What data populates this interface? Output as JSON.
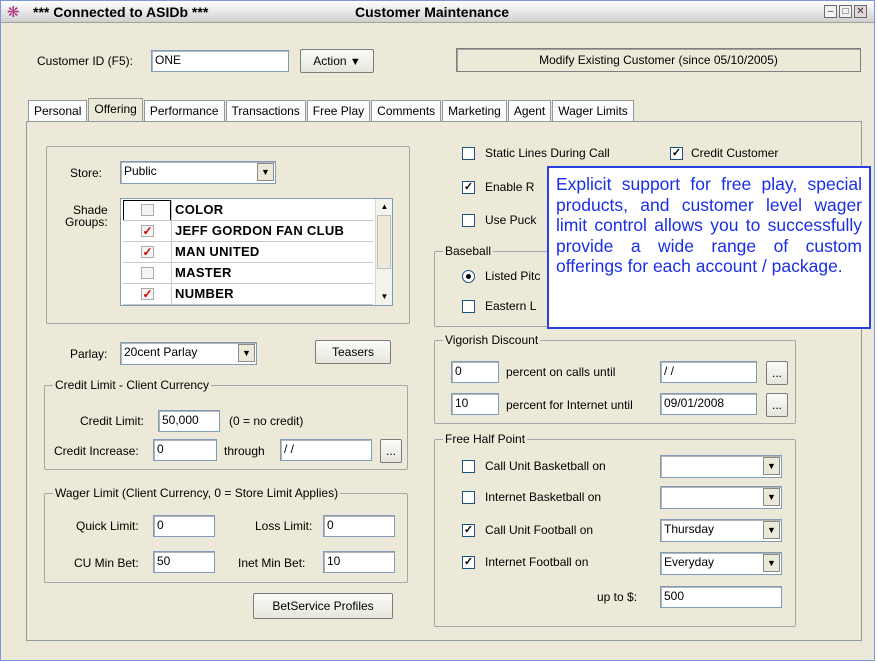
{
  "window": {
    "connection_title": "***   Connected to ASIDb   ***",
    "title": "Customer Maintenance",
    "controls": [
      "minimize",
      "maximize",
      "close"
    ]
  },
  "header": {
    "customer_id_label": "Customer ID (F5):",
    "customer_id_value": "ONE",
    "action_label": "Action",
    "status_text": "Modify Existing Customer (since 05/10/2005)"
  },
  "tabs": [
    {
      "label": "Personal",
      "active": false
    },
    {
      "label": "Offering",
      "active": true
    },
    {
      "label": "Performance",
      "active": false
    },
    {
      "label": "Transactions",
      "active": false
    },
    {
      "label": "Free Play",
      "active": false
    },
    {
      "label": "Comments",
      "active": false
    },
    {
      "label": "Marketing",
      "active": false
    },
    {
      "label": "Agent",
      "active": false
    },
    {
      "label": "Wager Limits",
      "active": false
    }
  ],
  "store": {
    "label": "Store:",
    "value": "Public"
  },
  "shade_groups": {
    "label_line1": "Shade",
    "label_line2": "Groups:",
    "items": [
      {
        "name": "COLOR",
        "checked": false
      },
      {
        "name": "JEFF GORDON FAN CLUB",
        "checked": true
      },
      {
        "name": "MAN UNITED",
        "checked": true
      },
      {
        "name": "MASTER",
        "checked": false
      },
      {
        "name": "NUMBER",
        "checked": true
      }
    ]
  },
  "parlay": {
    "label": "Parlay:",
    "value": "20cent Parlay",
    "teasers_label": "Teasers"
  },
  "credit_limit": {
    "group_title": "Credit Limit - Client Currency",
    "credit_limit_label": "Credit Limit:",
    "credit_limit_value": "50,000",
    "credit_limit_hint": "(0 = no credit)",
    "credit_increase_label": "Credit Increase:",
    "credit_increase_value": "0",
    "through_label": "through",
    "through_value": " / /",
    "browse_label": "..."
  },
  "wager_limit": {
    "group_title": "Wager Limit (Client Currency, 0 = Store Limit Applies)",
    "quick_limit_label": "Quick Limit:",
    "quick_limit_value": "0",
    "loss_limit_label": "Loss Limit:",
    "loss_limit_value": "0",
    "cu_min_bet_label": "CU Min Bet:",
    "cu_min_bet_value": "50",
    "inet_min_bet_label": "Inet Min Bet:",
    "inet_min_bet_value": "10",
    "betservice_label": "BetService Profiles"
  },
  "options": {
    "static_lines_label": "Static Lines During Call",
    "static_lines_checked": false,
    "credit_customer_label": "Credit Customer",
    "credit_customer_checked": true,
    "enable_label": "Enable R",
    "enable_checked": true,
    "use_puck_label": "Use Puck",
    "use_puck_checked": false
  },
  "baseball": {
    "group_title": "Baseball",
    "listed_pitchers_label": "Listed Pitc",
    "listed_pitchers_selected": true,
    "eastern_label": "Eastern L",
    "eastern_checked": false
  },
  "vigorish": {
    "group_title": "Vigorish Discount",
    "calls_value": "0",
    "calls_label": "percent on calls until",
    "calls_date": " / /",
    "internet_value": "10",
    "internet_label": "percent for Internet until",
    "internet_date": "09/01/2008",
    "browse_label": "..."
  },
  "free_half_point": {
    "group_title": "Free Half Point",
    "rows": [
      {
        "label": "Call Unit Basketball on",
        "checked": false,
        "value": ""
      },
      {
        "label": "Internet Basketball on",
        "checked": false,
        "value": ""
      },
      {
        "label": "Call Unit Football on",
        "checked": true,
        "value": "Thursday"
      },
      {
        "label": "Internet Football on",
        "checked": true,
        "value": "Everyday"
      }
    ],
    "up_to_label": "up to $:",
    "up_to_value": "500"
  },
  "callout": {
    "text": "Explicit support for free play, special products, and customer level wager limit control allows you to successfully provide a wide range of custom offerings for each account / package."
  },
  "colors": {
    "callout_text": "#1a2ee6",
    "checkmark": "#d00000",
    "window_bg": "#ece9d8"
  }
}
